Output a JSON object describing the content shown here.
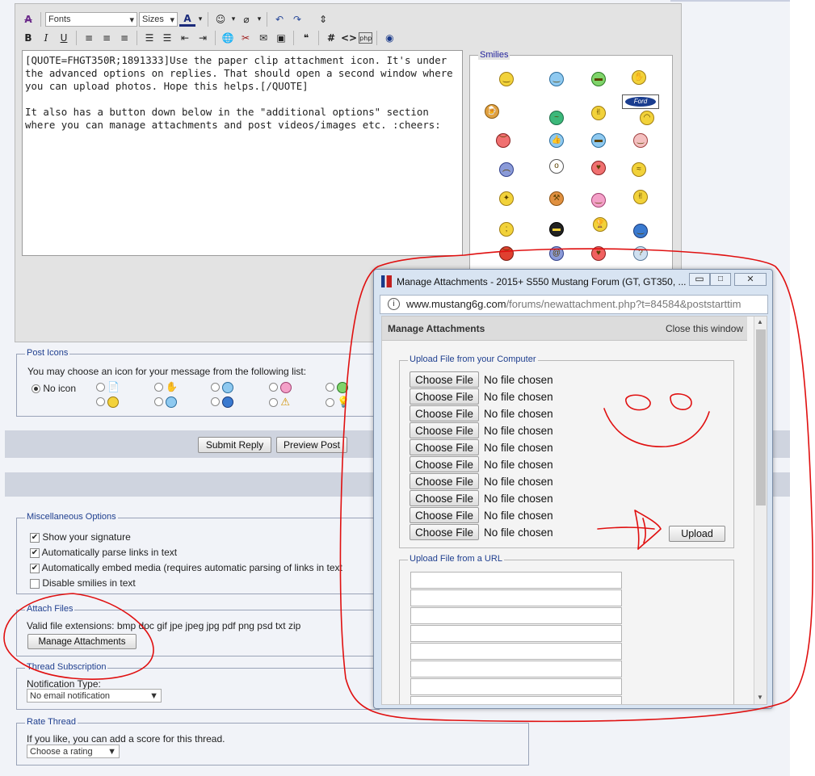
{
  "toolbar": {
    "font_select": "Fonts",
    "size_select": "Sizes"
  },
  "editor": {
    "text": "[QUOTE=FHGT350R;1891333]Use the paper clip attachment icon. It's under the advanced options on replies. That should open a second window where you can upload photos. Hope this helps.[/QUOTE]\n\nIt also has a button down below in the \"additional options\" section where you can manage attachments and post videos/images etc. :cheers:"
  },
  "smilies": {
    "title": "Smilies",
    "ford_label": "Ford"
  },
  "post_icons": {
    "title": "Post Icons",
    "instruction": "You may choose an icon for your message from the following list:",
    "no_icon": "No icon"
  },
  "actions": {
    "submit": "Submit Reply",
    "preview": "Preview Post"
  },
  "misc": {
    "title": "Miscellaneous Options",
    "options": [
      {
        "label": "Show your signature",
        "checked": true
      },
      {
        "label": "Automatically parse links in text",
        "checked": true
      },
      {
        "label": "Automatically embed media (requires automatic parsing of links in text",
        "checked": true
      },
      {
        "label": "Disable smilies in text",
        "checked": false
      }
    ]
  },
  "attach": {
    "title": "Attach Files",
    "extensions": "Valid file extensions: bmp doc gif jpe jpeg jpg pdf png psd txt zip",
    "button": "Manage Attachments"
  },
  "subscription": {
    "title": "Thread Subscription",
    "label": "Notification Type:",
    "value": "No email notification"
  },
  "rate": {
    "title": "Rate Thread",
    "label": "If you like, you can add a score for this thread.",
    "value": "Choose a rating"
  },
  "popup": {
    "window_title": "Manage Attachments - 2015+ S550 Mustang Forum (GT, GT350, ...",
    "url_host": "www.mustang6g.com",
    "url_path": "/forums/newattachment.php?t=84584&poststarttim",
    "header": "Manage Attachments",
    "close_link": "Close this window",
    "upload_computer_title": "Upload File from your Computer",
    "choose_label": "Choose File",
    "no_file": "No file chosen",
    "upload_button": "Upload",
    "upload_url_title": "Upload File from a URL"
  },
  "colors": {
    "annotation_red": "#e01010",
    "legend_blue": "#1f3f8f"
  }
}
